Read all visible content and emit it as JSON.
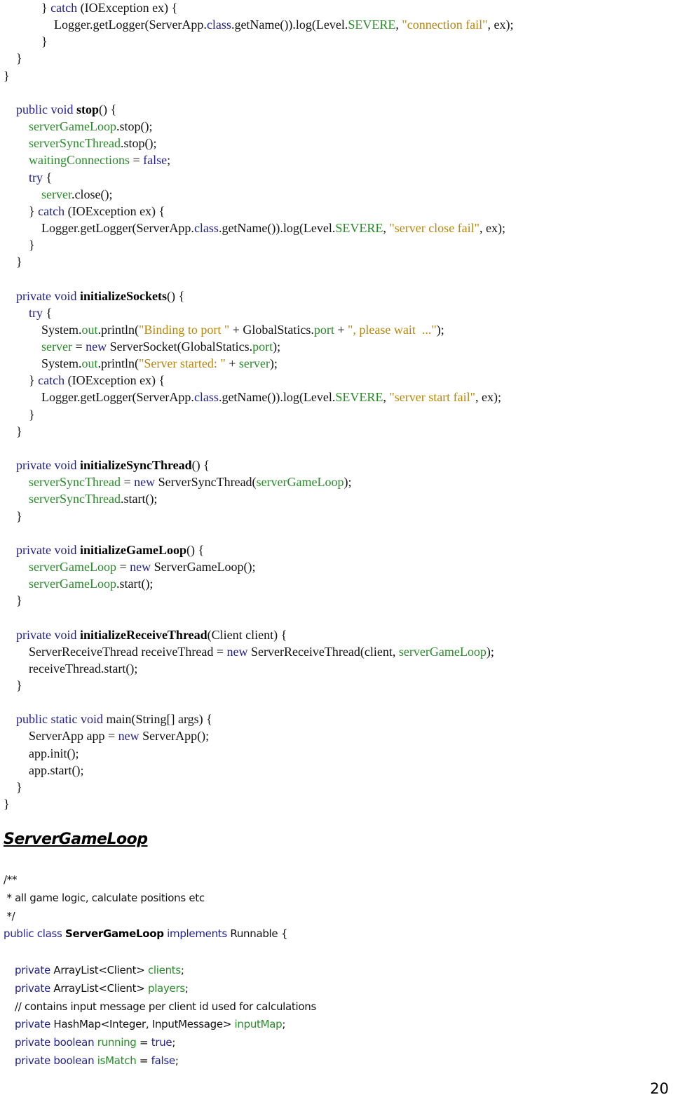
{
  "document": {
    "page_number": "20",
    "section_title": "ServerGameLoop",
    "colors": {
      "keyword": "#1f1f8f",
      "field": "#2a8a2a",
      "string": "#b8860b",
      "text": "#111111"
    }
  },
  "code_block_1": [
    {
      "indent": 3,
      "tokens": [
        {
          "t": "} ",
          "c": "plain"
        },
        {
          "t": "catch",
          "c": "kw"
        },
        {
          "t": " (IOException ex) {",
          "c": "plain"
        }
      ]
    },
    {
      "indent": 4,
      "tokens": [
        {
          "t": "Logger.getLogger(ServerApp.",
          "c": "plain"
        },
        {
          "t": "class",
          "c": "kw"
        },
        {
          "t": ".getName()).log(Level.",
          "c": "plain"
        },
        {
          "t": "SEVERE",
          "c": "fld"
        },
        {
          "t": ", ",
          "c": "plain"
        },
        {
          "t": "\"connection fail\"",
          "c": "str"
        },
        {
          "t": ", ex);",
          "c": "plain"
        }
      ]
    },
    {
      "indent": 3,
      "tokens": [
        {
          "t": "}",
          "c": "plain"
        }
      ]
    },
    {
      "indent": 1,
      "tokens": [
        {
          "t": "}",
          "c": "plain"
        }
      ]
    },
    {
      "indent": 0,
      "tokens": [
        {
          "t": "}",
          "c": "plain"
        }
      ]
    },
    {
      "indent": 0,
      "tokens": []
    },
    {
      "indent": 1,
      "tokens": [
        {
          "t": "public void ",
          "c": "kw"
        },
        {
          "t": "stop",
          "c": "bold"
        },
        {
          "t": "() {",
          "c": "plain"
        }
      ]
    },
    {
      "indent": 2,
      "tokens": [
        {
          "t": "serverGameLoop",
          "c": "fld"
        },
        {
          "t": ".stop();",
          "c": "plain"
        }
      ]
    },
    {
      "indent": 2,
      "tokens": [
        {
          "t": "serverSyncThread",
          "c": "fld"
        },
        {
          "t": ".stop();",
          "c": "plain"
        }
      ]
    },
    {
      "indent": 2,
      "tokens": [
        {
          "t": "waitingConnections",
          "c": "fld"
        },
        {
          "t": " = ",
          "c": "plain"
        },
        {
          "t": "false",
          "c": "kw"
        },
        {
          "t": ";",
          "c": "plain"
        }
      ]
    },
    {
      "indent": 2,
      "tokens": [
        {
          "t": "try",
          "c": "kw"
        },
        {
          "t": " {",
          "c": "plain"
        }
      ]
    },
    {
      "indent": 3,
      "tokens": [
        {
          "t": "server",
          "c": "fld"
        },
        {
          "t": ".close();",
          "c": "plain"
        }
      ]
    },
    {
      "indent": 2,
      "tokens": [
        {
          "t": "} ",
          "c": "plain"
        },
        {
          "t": "catch",
          "c": "kw"
        },
        {
          "t": " (IOException ex) {",
          "c": "plain"
        }
      ]
    },
    {
      "indent": 3,
      "tokens": [
        {
          "t": "Logger.getLogger(ServerApp.",
          "c": "plain"
        },
        {
          "t": "class",
          "c": "kw"
        },
        {
          "t": ".getName()).log(Level.",
          "c": "plain"
        },
        {
          "t": "SEVERE",
          "c": "fld"
        },
        {
          "t": ", ",
          "c": "plain"
        },
        {
          "t": "\"server close fail\"",
          "c": "str"
        },
        {
          "t": ", ex);",
          "c": "plain"
        }
      ]
    },
    {
      "indent": 2,
      "tokens": [
        {
          "t": "}",
          "c": "plain"
        }
      ]
    },
    {
      "indent": 1,
      "tokens": [
        {
          "t": "}",
          "c": "plain"
        }
      ]
    },
    {
      "indent": 0,
      "tokens": []
    },
    {
      "indent": 1,
      "tokens": [
        {
          "t": "private void ",
          "c": "kw"
        },
        {
          "t": "initializeSockets",
          "c": "bold"
        },
        {
          "t": "() {",
          "c": "plain"
        }
      ]
    },
    {
      "indent": 2,
      "tokens": [
        {
          "t": "try",
          "c": "kw"
        },
        {
          "t": " {",
          "c": "plain"
        }
      ]
    },
    {
      "indent": 3,
      "tokens": [
        {
          "t": "System.",
          "c": "plain"
        },
        {
          "t": "out",
          "c": "fld"
        },
        {
          "t": ".println(",
          "c": "plain"
        },
        {
          "t": "\"Binding to port \"",
          "c": "str"
        },
        {
          "t": " + GlobalStatics.",
          "c": "plain"
        },
        {
          "t": "port",
          "c": "fld"
        },
        {
          "t": " + ",
          "c": "plain"
        },
        {
          "t": "\", please wait  ...\"",
          "c": "str"
        },
        {
          "t": ");",
          "c": "plain"
        }
      ]
    },
    {
      "indent": 3,
      "tokens": [
        {
          "t": "server",
          "c": "fld"
        },
        {
          "t": " = ",
          "c": "plain"
        },
        {
          "t": "new",
          "c": "kw"
        },
        {
          "t": " ServerSocket(GlobalStatics.",
          "c": "plain"
        },
        {
          "t": "port",
          "c": "fld"
        },
        {
          "t": ");",
          "c": "plain"
        }
      ]
    },
    {
      "indent": 3,
      "tokens": [
        {
          "t": "System.",
          "c": "plain"
        },
        {
          "t": "out",
          "c": "fld"
        },
        {
          "t": ".println(",
          "c": "plain"
        },
        {
          "t": "\"Server started: \"",
          "c": "str"
        },
        {
          "t": " + ",
          "c": "plain"
        },
        {
          "t": "server",
          "c": "fld"
        },
        {
          "t": ");",
          "c": "plain"
        }
      ]
    },
    {
      "indent": 2,
      "tokens": [
        {
          "t": "} ",
          "c": "plain"
        },
        {
          "t": "catch",
          "c": "kw"
        },
        {
          "t": " (IOException ex) {",
          "c": "plain"
        }
      ]
    },
    {
      "indent": 3,
      "tokens": [
        {
          "t": "Logger.getLogger(ServerApp.",
          "c": "plain"
        },
        {
          "t": "class",
          "c": "kw"
        },
        {
          "t": ".getName()).log(Level.",
          "c": "plain"
        },
        {
          "t": "SEVERE",
          "c": "fld"
        },
        {
          "t": ", ",
          "c": "plain"
        },
        {
          "t": "\"server start fail\"",
          "c": "str"
        },
        {
          "t": ", ex);",
          "c": "plain"
        }
      ]
    },
    {
      "indent": 2,
      "tokens": [
        {
          "t": "}",
          "c": "plain"
        }
      ]
    },
    {
      "indent": 1,
      "tokens": [
        {
          "t": "}",
          "c": "plain"
        }
      ]
    },
    {
      "indent": 0,
      "tokens": []
    },
    {
      "indent": 1,
      "tokens": [
        {
          "t": "private void ",
          "c": "kw"
        },
        {
          "t": "initializeSyncThread",
          "c": "bold"
        },
        {
          "t": "() {",
          "c": "plain"
        }
      ]
    },
    {
      "indent": 2,
      "tokens": [
        {
          "t": "serverSyncThread",
          "c": "fld"
        },
        {
          "t": " = ",
          "c": "plain"
        },
        {
          "t": "new",
          "c": "kw"
        },
        {
          "t": " ServerSyncThread(",
          "c": "plain"
        },
        {
          "t": "serverGameLoop",
          "c": "fld"
        },
        {
          "t": ");",
          "c": "plain"
        }
      ]
    },
    {
      "indent": 2,
      "tokens": [
        {
          "t": "serverSyncThread",
          "c": "fld"
        },
        {
          "t": ".start();",
          "c": "plain"
        }
      ]
    },
    {
      "indent": 1,
      "tokens": [
        {
          "t": "}",
          "c": "plain"
        }
      ]
    },
    {
      "indent": 0,
      "tokens": []
    },
    {
      "indent": 1,
      "tokens": [
        {
          "t": "private void ",
          "c": "kw"
        },
        {
          "t": "initializeGameLoop",
          "c": "bold"
        },
        {
          "t": "() {",
          "c": "plain"
        }
      ]
    },
    {
      "indent": 2,
      "tokens": [
        {
          "t": "serverGameLoop",
          "c": "fld"
        },
        {
          "t": " = ",
          "c": "plain"
        },
        {
          "t": "new",
          "c": "kw"
        },
        {
          "t": " ServerGameLoop();",
          "c": "plain"
        }
      ]
    },
    {
      "indent": 2,
      "tokens": [
        {
          "t": "serverGameLoop",
          "c": "fld"
        },
        {
          "t": ".start();",
          "c": "plain"
        }
      ]
    },
    {
      "indent": 1,
      "tokens": [
        {
          "t": "}",
          "c": "plain"
        }
      ]
    },
    {
      "indent": 0,
      "tokens": []
    },
    {
      "indent": 1,
      "tokens": [
        {
          "t": "private void ",
          "c": "kw"
        },
        {
          "t": "initializeReceiveThread",
          "c": "bold"
        },
        {
          "t": "(Client client) {",
          "c": "plain"
        }
      ]
    },
    {
      "indent": 2,
      "tokens": [
        {
          "t": "ServerReceiveThread receiveThread = ",
          "c": "plain"
        },
        {
          "t": "new",
          "c": "kw"
        },
        {
          "t": " ServerReceiveThread(client, ",
          "c": "plain"
        },
        {
          "t": "serverGameLoop",
          "c": "fld"
        },
        {
          "t": ");",
          "c": "plain"
        }
      ]
    },
    {
      "indent": 2,
      "tokens": [
        {
          "t": "receiveThread.start();",
          "c": "plain"
        }
      ]
    },
    {
      "indent": 1,
      "tokens": [
        {
          "t": "}",
          "c": "plain"
        }
      ]
    },
    {
      "indent": 0,
      "tokens": []
    },
    {
      "indent": 1,
      "tokens": [
        {
          "t": "public static void ",
          "c": "kw"
        },
        {
          "t": "main(String[] args) {",
          "c": "plain"
        }
      ]
    },
    {
      "indent": 2,
      "tokens": [
        {
          "t": "ServerApp app = ",
          "c": "plain"
        },
        {
          "t": "new",
          "c": "kw"
        },
        {
          "t": " ServerApp();",
          "c": "plain"
        }
      ]
    },
    {
      "indent": 2,
      "tokens": [
        {
          "t": "app.init();",
          "c": "plain"
        }
      ]
    },
    {
      "indent": 2,
      "tokens": [
        {
          "t": "app.start();",
          "c": "plain"
        }
      ]
    },
    {
      "indent": 1,
      "tokens": [
        {
          "t": "}",
          "c": "plain"
        }
      ]
    },
    {
      "indent": 0,
      "tokens": [
        {
          "t": "}",
          "c": "plain"
        }
      ]
    }
  ],
  "code_block_2": [
    {
      "indent": 0,
      "tokens": [
        {
          "t": "/**",
          "c": "plain"
        }
      ]
    },
    {
      "indent": 0,
      "tokens": [
        {
          "t": " * all game logic, calculate positions etc",
          "c": "plain"
        }
      ]
    },
    {
      "indent": 0,
      "tokens": [
        {
          "t": " */",
          "c": "plain"
        }
      ]
    },
    {
      "indent": 0,
      "tokens": [
        {
          "t": "public class ",
          "c": "kw"
        },
        {
          "t": "ServerGameLoop",
          "c": "bold"
        },
        {
          "t": " implements",
          "c": "kw"
        },
        {
          "t": " Runnable {",
          "c": "plain"
        }
      ]
    },
    {
      "indent": 0,
      "tokens": []
    },
    {
      "indent": 1,
      "tokens": [
        {
          "t": "private",
          "c": "kw"
        },
        {
          "t": " ArrayList<Client> ",
          "c": "plain"
        },
        {
          "t": "clients",
          "c": "fld"
        },
        {
          "t": ";",
          "c": "plain"
        }
      ]
    },
    {
      "indent": 1,
      "tokens": [
        {
          "t": "private",
          "c": "kw"
        },
        {
          "t": " ArrayList<Client> ",
          "c": "plain"
        },
        {
          "t": "players",
          "c": "fld"
        },
        {
          "t": ";",
          "c": "plain"
        }
      ]
    },
    {
      "indent": 1,
      "tokens": [
        {
          "t": "// contains input message per client id used for calculations",
          "c": "plain"
        }
      ]
    },
    {
      "indent": 1,
      "tokens": [
        {
          "t": "private",
          "c": "kw"
        },
        {
          "t": " HashMap<Integer, InputMessage> ",
          "c": "plain"
        },
        {
          "t": "inputMap",
          "c": "fld"
        },
        {
          "t": ";",
          "c": "plain"
        }
      ]
    },
    {
      "indent": 1,
      "tokens": [
        {
          "t": "private boolean ",
          "c": "kw"
        },
        {
          "t": "running",
          "c": "fld"
        },
        {
          "t": " = ",
          "c": "plain"
        },
        {
          "t": "true",
          "c": "kw"
        },
        {
          "t": ";",
          "c": "plain"
        }
      ]
    },
    {
      "indent": 1,
      "tokens": [
        {
          "t": "private boolean ",
          "c": "kw"
        },
        {
          "t": "isMatch",
          "c": "fld"
        },
        {
          "t": " = ",
          "c": "plain"
        },
        {
          "t": "false",
          "c": "kw"
        },
        {
          "t": ";",
          "c": "plain"
        }
      ]
    }
  ]
}
